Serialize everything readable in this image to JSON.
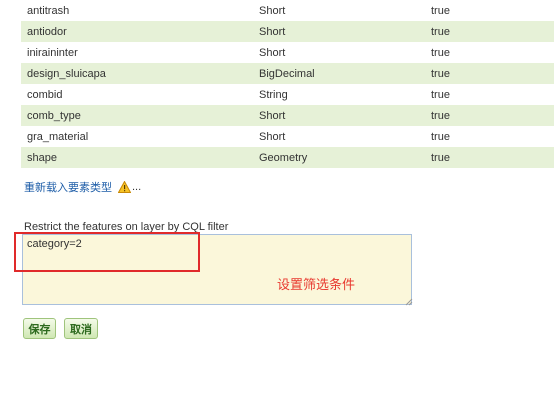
{
  "attributes": {
    "rows": [
      {
        "name": "antitrash",
        "type": "Short",
        "nillable": "true"
      },
      {
        "name": "antiodor",
        "type": "Short",
        "nillable": "true"
      },
      {
        "name": "iniraininter",
        "type": "Short",
        "nillable": "true"
      },
      {
        "name": "design_sluicapa",
        "type": "BigDecimal",
        "nillable": "true"
      },
      {
        "name": "combid",
        "type": "String",
        "nillable": "true"
      },
      {
        "name": "comb_type",
        "type": "Short",
        "nillable": "true"
      },
      {
        "name": "gra_material",
        "type": "Short",
        "nillable": "true"
      },
      {
        "name": "shape",
        "type": "Geometry",
        "nillable": "true"
      }
    ]
  },
  "reload": {
    "label": "重新载入要素类型",
    "icon": "warning-icon",
    "ellipsis": "..."
  },
  "filter": {
    "label": "Restrict the features on layer by CQL filter",
    "value": "category=2"
  },
  "annotation": {
    "text": "设置筛选条件",
    "color": "#e8382e"
  },
  "buttons": {
    "save": "保存",
    "cancel": "取消"
  },
  "colors": {
    "row_alt": "#e6f1d7",
    "link": "#1f5ea8",
    "textarea_bg": "#fbf7da",
    "highlight": "#e02a2a"
  }
}
